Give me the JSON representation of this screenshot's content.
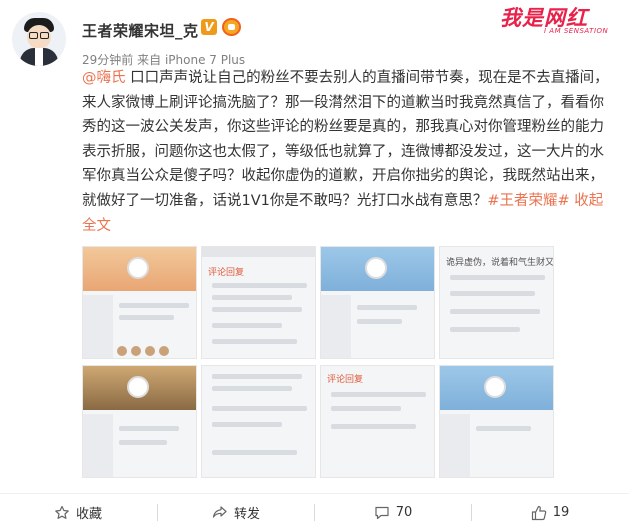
{
  "author": {
    "name": "王者荣耀宋坦_克",
    "verified_mark": "V",
    "time": "29分钟前",
    "source_prefix": "来自",
    "source": "iPhone 7 Plus"
  },
  "watermark": {
    "cn": "我是网红",
    "en": "I AM SENSATION"
  },
  "post": {
    "mention": "@嗨氏",
    "body": " 口口声声说让自己的粉丝不要去别人的直播间带节奏，现在是不去直播间，来人家微博上刷评论搞洗脑了？那一段潸然泪下的道歉当时我竟然真信了，看看你秀的这一波公关发声，你这些评论的粉丝要是真的，那我真心对你管理粉丝的能力表示折服，问题你这也太假了，等级低也就算了，连微博都没发过，这一大片的水军你真当公众是傻子吗？收起你虚伪的道歉，开启你拙劣的舆论，我既然站出来，就做好了一切准备，话说1V1你是不敢吗？光打口水战有意思？",
    "hashtag": "#王者荣耀#",
    "collapse": "收起全文"
  },
  "thumbnails": [
    {
      "style": "profile",
      "sky": "orange",
      "text": ""
    },
    {
      "style": "comments",
      "sky": "",
      "text": "评论回复"
    },
    {
      "style": "profile",
      "sky": "blue",
      "text": ""
    },
    {
      "style": "chat",
      "sky": "",
      "text": "诡异虚伪，说着和气生财又在运"
    },
    {
      "style": "profile",
      "sky": "brown",
      "text": ""
    },
    {
      "style": "comments",
      "sky": "",
      "text": "评论回复"
    },
    {
      "style": "comments",
      "sky": "",
      "text": "评论回复"
    },
    {
      "style": "profile",
      "sky": "blue",
      "text": ""
    }
  ],
  "toolbar": {
    "favorite": "收藏",
    "repost": "转发",
    "comments": "70",
    "likes": "19"
  }
}
